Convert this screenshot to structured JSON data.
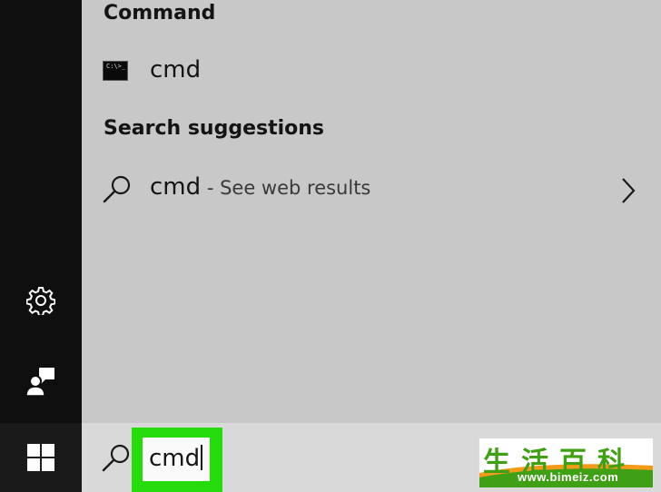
{
  "results": {
    "command_heading": "Command",
    "best_match": {
      "title": "cmd",
      "icon": "command-prompt-icon",
      "icon_glyph": "C:\\>_"
    },
    "suggestions_heading": "Search suggestions",
    "web_suggestion": {
      "query": "cmd",
      "separator": " - ",
      "hint": "See web results",
      "icon": "search-icon"
    }
  },
  "sidebar": {
    "icons": [
      "gear-icon",
      "people-icon"
    ],
    "start": "windows-logo-icon"
  },
  "taskbar": {
    "search_icon": "search-icon",
    "search_value": "cmd",
    "highlight_color": "#27dc0c"
  },
  "watermark": {
    "characters": "生活百科",
    "url": "www.bimeiz.com"
  }
}
